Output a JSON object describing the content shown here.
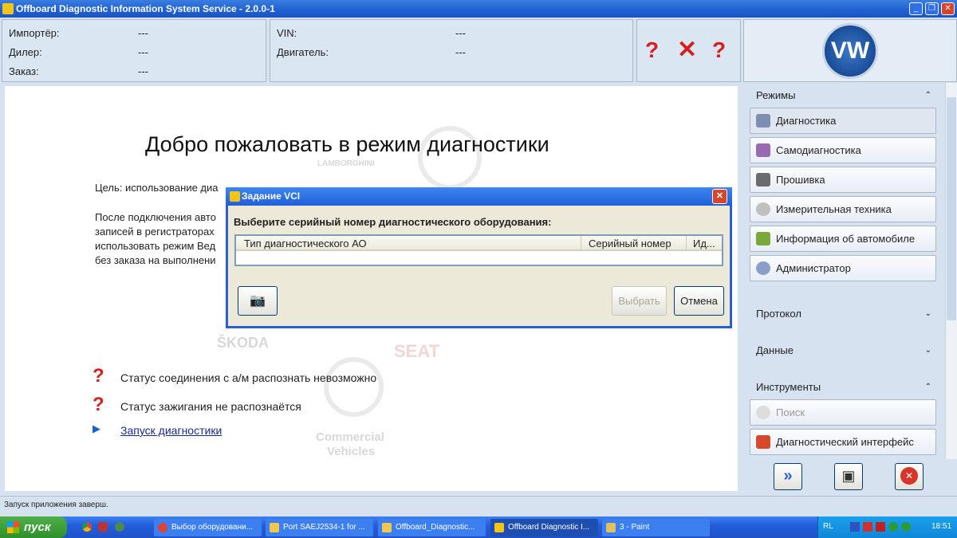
{
  "window": {
    "title": "Offboard Diagnostic Information System Service - 2.0.0-1",
    "minimize": "_",
    "restore": "❐",
    "close": "✕"
  },
  "header": {
    "left": [
      {
        "label": "Импортёр:",
        "value": "---"
      },
      {
        "label": "Дилер:",
        "value": "---"
      },
      {
        "label": "Заказ:",
        "value": "---"
      }
    ],
    "right": [
      {
        "label": "VIN:",
        "value": "---"
      },
      {
        "label": "Двигатель:",
        "value": "---"
      }
    ],
    "logo": "VW"
  },
  "main": {
    "title": "Добро пожаловать в режим диагностики",
    "lines": [
      "Цель: использование диа",
      "После подключения авто",
      "записей в регистраторах",
      "использовать режим Вед",
      "без заказа на выполнени"
    ],
    "watermarks": [
      "LAMBORGHINI",
      "ŠKODA",
      "SEAT",
      "Commercial",
      "Vehicles"
    ],
    "status1": "Статус соединения с а/м распознать невозможно",
    "status2": "Статус зажигания не распознаётся",
    "start_link": "Запуск диагностики"
  },
  "sidebar": {
    "sections": {
      "modes": "Режимы",
      "protocol": "Протокол",
      "data": "Данные",
      "tools": "Инструменты"
    },
    "modes": [
      "Диагностика",
      "Самодиагностика",
      "Прошивка",
      "Измерительная техника",
      "Информация об автомобиле",
      "Администратор"
    ],
    "tools": [
      "Поиск",
      "Диагностический интерфейс"
    ]
  },
  "dialog": {
    "title": "Задание VCI",
    "prompt": "Выберите серийный номер диагностического оборудования:",
    "columns": [
      "Тип диагностического АО",
      "Серийный номер",
      "Ид..."
    ],
    "select": "Выбрать",
    "cancel": "Отмена"
  },
  "statusbar": {
    "text": "Запуск приложения заверш."
  },
  "taskbar": {
    "start": "пуск",
    "items": [
      "Выбор оборудовани...",
      "Port SAEJ2534-1 for ...",
      "Offboard_Diagnostic...",
      "Offboard Diagnostic I...",
      "3 - Paint"
    ],
    "lang": "RL",
    "clock": "18:51"
  }
}
